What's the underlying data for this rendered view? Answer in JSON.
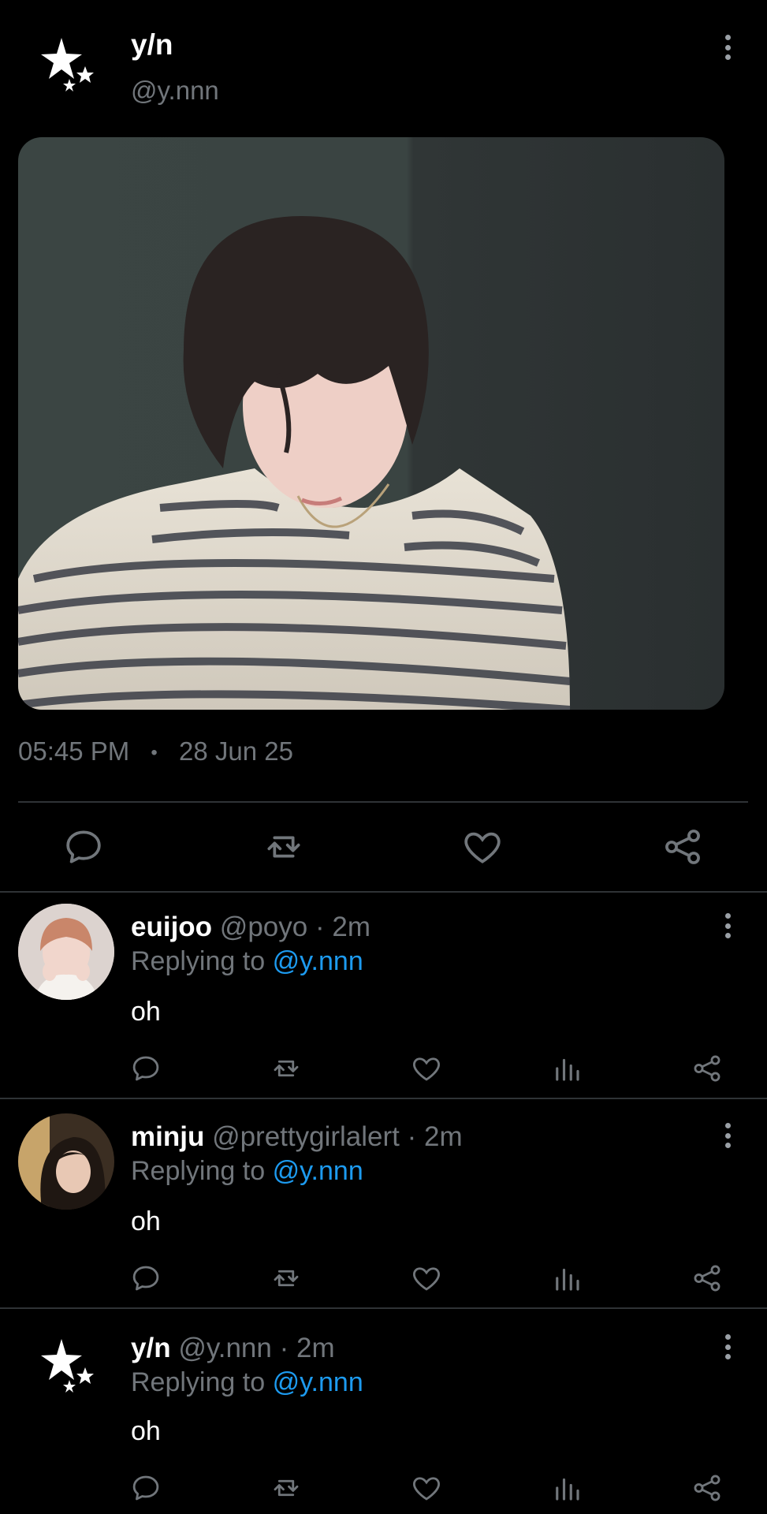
{
  "post": {
    "display_name": "y/n",
    "handle": "@y.nnn",
    "time": "05:45 PM",
    "separator": "•",
    "date": "28 Jun 25"
  },
  "replies": [
    {
      "name": "euijoo",
      "handle": "@poyo",
      "time": "· 2m",
      "replying_prefix": "Replying to",
      "replying_to": "@y.nnn",
      "text": "oh"
    },
    {
      "name": "minju",
      "handle": "@prettygirlalert",
      "time": "· 2m",
      "replying_prefix": "Replying to",
      "replying_to": "@y.nnn",
      "text": "oh"
    },
    {
      "name": "y/n",
      "handle": "@y.nnn",
      "time": "· 2m",
      "replying_prefix": "Replying to",
      "replying_to": "@y.nnn",
      "text": "oh"
    }
  ],
  "icons": {
    "reply": "speech-bubble-icon",
    "repost": "repost-icon",
    "like": "heart-icon",
    "views": "bar-chart-icon",
    "share": "share-icon",
    "more": "vertical-dots-icon"
  },
  "colors": {
    "background": "#000000",
    "muted": "#71767b",
    "link": "#1d9bf0",
    "divider": "#2f3336"
  }
}
